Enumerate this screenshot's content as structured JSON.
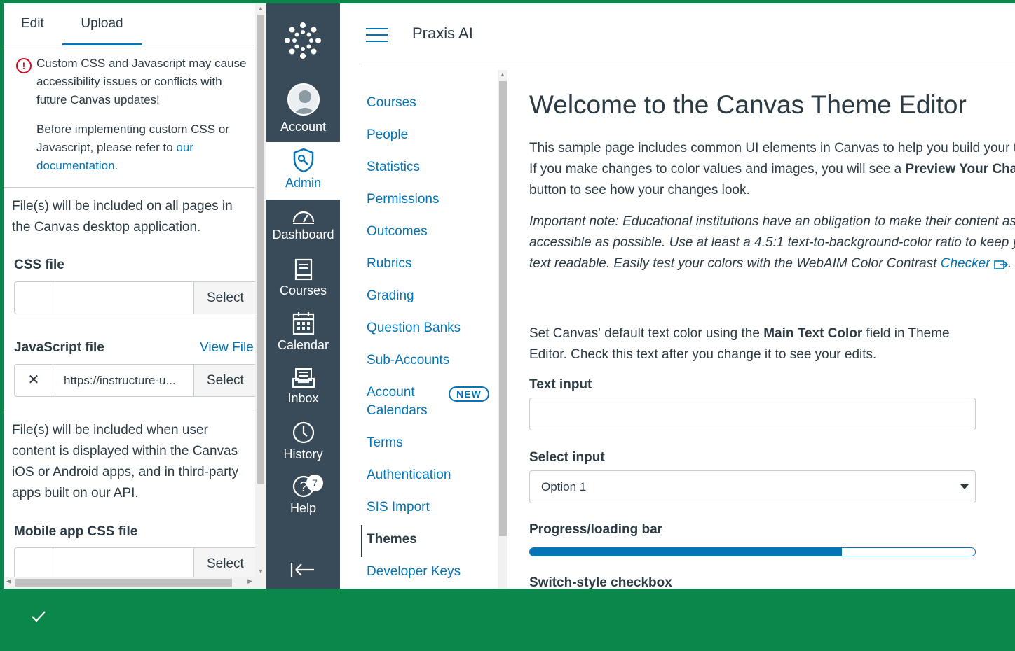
{
  "editor": {
    "tabs": [
      {
        "label": "Edit"
      },
      {
        "label": "Upload"
      }
    ],
    "warning": {
      "line1": "Custom CSS and Javascript may cause accessibility issues or conflicts with future Canvas updates!",
      "line2_prefix": "Before implementing custom CSS or Javascript, please refer to ",
      "line2_link": "our documentation",
      "line2_suffix": "."
    },
    "desktop_desc": "File(s) will be included on all pages in the Canvas desktop application.",
    "css_file": {
      "label": "CSS file",
      "value": "",
      "select": "Select"
    },
    "js_file": {
      "label": "JavaScript file",
      "view": "View File",
      "value": "https://instructure-u...",
      "select": "Select"
    },
    "mobile_desc": "File(s) will be included when user content is displayed within the Canvas iOS or Android apps, and in third-party apps built on our API.",
    "mobile_css_file": {
      "label": "Mobile app CSS file",
      "value": "",
      "select": "Select"
    }
  },
  "global_nav": {
    "items": [
      {
        "label": "Account",
        "icon": "user-avatar-icon"
      },
      {
        "label": "Admin",
        "icon": "admin-shield-icon",
        "active": true
      },
      {
        "label": "Dashboard",
        "icon": "dashboard-gauge-icon"
      },
      {
        "label": "Courses",
        "icon": "book-icon"
      },
      {
        "label": "Calendar",
        "icon": "calendar-icon"
      },
      {
        "label": "Inbox",
        "icon": "inbox-icon"
      },
      {
        "label": "History",
        "icon": "clock-icon"
      },
      {
        "label": "Help",
        "icon": "help-icon",
        "badge": "7"
      }
    ]
  },
  "header": {
    "title": "Praxis AI"
  },
  "subnav": {
    "items": [
      {
        "label": "Courses"
      },
      {
        "label": "People"
      },
      {
        "label": "Statistics"
      },
      {
        "label": "Permissions"
      },
      {
        "label": "Outcomes"
      },
      {
        "label": "Rubrics"
      },
      {
        "label": "Grading"
      },
      {
        "label": "Question Banks"
      },
      {
        "label": "Sub-Accounts"
      },
      {
        "label": "Account Calendars",
        "badge": "NEW"
      },
      {
        "label": "Terms"
      },
      {
        "label": "Authentication"
      },
      {
        "label": "SIS Import"
      },
      {
        "label": "Themes",
        "active": true
      },
      {
        "label": "Developer Keys"
      }
    ]
  },
  "main": {
    "title": "Welcome to the Canvas Theme Editor",
    "intro_prefix": "This sample page includes common UI elements in Canvas to help you build your theme. If you make changes to color values and images, you will see a ",
    "intro_bold": "Preview Your Changes",
    "intro_suffix": " button to see how your changes look.",
    "note": "Important note: Educational institutions have an obligation to make their content as accessible as possible. Use at least a 4.5:1 text-to-background-color ratio to keep your text readable. Easily test your colors with the WebAIM Color Contrast ",
    "note_link": "Checker",
    "note_end": ".",
    "maintext_prefix": "Set Canvas' default text color using the ",
    "maintext_bold": "Main Text Color",
    "maintext_suffix": " field in Theme Editor. Check this text after you change it to see your edits.",
    "text_input_label": "Text input",
    "select_input_label": "Select input",
    "select_value": "Option 1",
    "progress_label": "Progress/loading bar",
    "progress_value": 0.7,
    "switch_label": "Switch-style checkbox"
  },
  "colors": {
    "brand_green": "#0b874b",
    "nav_bg": "#394b58",
    "link": "#0374b5"
  }
}
